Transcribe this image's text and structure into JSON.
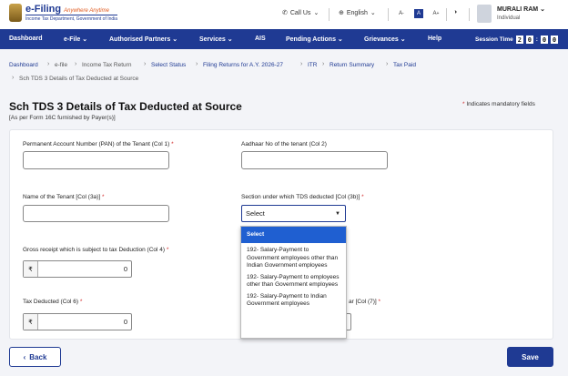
{
  "header": {
    "logo_main": "e-Filing",
    "logo_tagline": "Anywhere Anytime",
    "logo_sub": "Income Tax Department, Government of India",
    "call_us": "Call Us",
    "language": "English",
    "font_decrease": "A",
    "font_normal": "A",
    "font_increase": "A",
    "user_name": "MURALI RAM",
    "user_role": "Individual"
  },
  "nav": {
    "items": [
      "Dashboard",
      "e-File",
      "Authorised Partners",
      "Services",
      "AIS",
      "Pending Actions",
      "Grievances",
      "Help"
    ],
    "session_label": "Session Time",
    "session_digits": [
      "2",
      "0",
      ":",
      "0",
      "0"
    ]
  },
  "breadcrumb": {
    "items": [
      "Dashboard",
      "e-file",
      "Income Tax Return",
      "Select Status",
      "Filing Returns for A.Y. 2026-27",
      "ITR",
      "Return Summary",
      "Tax Paid"
    ],
    "current": "Sch TDS 3 Details of Tax Deducted at Source"
  },
  "page": {
    "title": "Sch TDS 3 Details of Tax Deducted at Source",
    "subtitle": "[As per Form 16C furnished by Payer(s)]",
    "mandatory_note": "Indicates mandatory fields",
    "req_marker": "*"
  },
  "form": {
    "pan_label": "Permanent Account Number (PAN) of the Tenant (Col 1)",
    "aadhaar_label": "Aadhaar No of the tenant (Col 2)",
    "name_label": "Name of the Tenant [Col (3a)]",
    "section_label": "Section under which TDS deducted [Col (3b)]",
    "section_selected": "Select",
    "gross_label": "Gross receipt which is subject to tax Deduction (Col 4)",
    "gross_value": "0",
    "tax_deducted_label": "Tax Deducted (Col 6)",
    "tax_deducted_value": "0",
    "partial_label": "ar [Col (7)]",
    "currency": "₹",
    "dropdown_options": [
      "Select",
      "192- Salary-Payment to Government employees other than Indian Government employees",
      "192- Salary-Payment to employees other than Government employees",
      "192- Salary-Payment to Indian Government employees"
    ]
  },
  "actions": {
    "back": "Back",
    "save": "Save"
  },
  "colors": {
    "brand": "#1f3a93",
    "required": "#d32f2f",
    "selected_option": "#1f5fd1"
  }
}
